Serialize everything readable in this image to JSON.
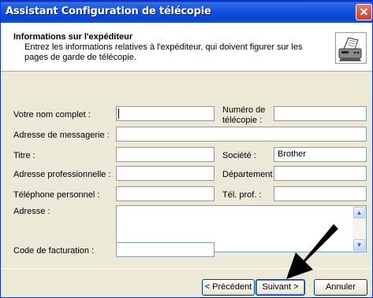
{
  "window": {
    "title": "Assistant Configuration de télécopie",
    "close_label": "✕"
  },
  "header": {
    "title": "Informations sur l'expéditeur",
    "description": "Entrez les informations relatives à l'expéditeur, qui doivent figurer sur les pages de garde de télécopie.",
    "icon": "fax-machine-icon"
  },
  "form": {
    "full_name": {
      "label": "Votre nom complet :",
      "value": ""
    },
    "fax_number": {
      "label": "Numéro de télécopie :",
      "value": ""
    },
    "email": {
      "label": "Adresse de messagerie :",
      "value": ""
    },
    "title": {
      "label": "Titre :",
      "value": ""
    },
    "company": {
      "label": "Société :",
      "value": "Brother"
    },
    "work_address": {
      "label": "Adresse professionnelle :",
      "value": ""
    },
    "department": {
      "label": "Département :",
      "value": ""
    },
    "home_phone": {
      "label": "Téléphone personnel :",
      "value": ""
    },
    "work_phone": {
      "label": "Tél. prof. :",
      "value": ""
    },
    "address": {
      "label": "Adresse :",
      "value": ""
    },
    "billing_code": {
      "label": "Code de facturation :",
      "value": ""
    }
  },
  "buttons": {
    "back": "< Précédent",
    "next": "Suivant >",
    "cancel": "Annuler"
  },
  "colors": {
    "titlebar": "#0a44cf",
    "dialog_bg": "#ece9d8",
    "input_border": "#7f9db9",
    "arrow": "#000000"
  }
}
